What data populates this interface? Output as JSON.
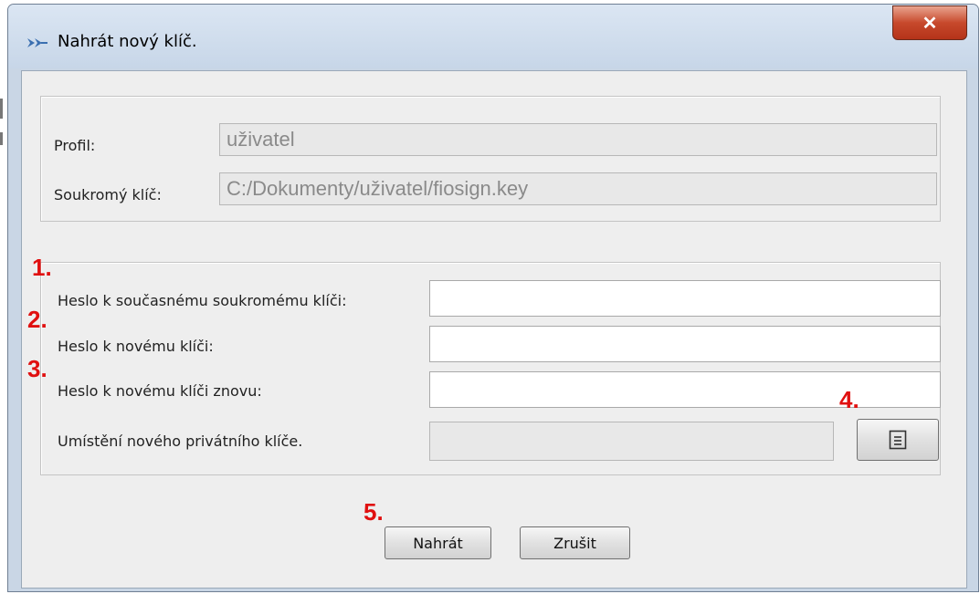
{
  "window": {
    "title": "Nahrát nový klíč.",
    "close_icon": "close-icon"
  },
  "profile_group": {
    "profile_label": "Profil:",
    "profile_value": "uživatel",
    "key_label": "Soukromý klíč:",
    "key_value": "C:/Dokumenty/uživatel/fiosign.key"
  },
  "password_group": {
    "current_password_label": "Heslo k současnému soukromému klíči:",
    "new_password_label": "Heslo k novému klíči:",
    "new_password_again_label": "Heslo k novému klíči znovu:",
    "location_label": "Umístění nového privátního klíče.",
    "current_password_value": "",
    "new_password_value": "",
    "new_password_again_value": "",
    "location_value": "",
    "browse_icon": "file-browse-icon"
  },
  "annotations": {
    "n1": "1.",
    "n2": "2.",
    "n3": "3.",
    "n4": "4.",
    "n5": "5."
  },
  "buttons": {
    "upload_label": "Nahrát",
    "cancel_label": "Zrušit"
  },
  "colors": {
    "annotation": "#e01010",
    "close_button": "#c7492c",
    "title_bar": "#d4e1f0"
  }
}
